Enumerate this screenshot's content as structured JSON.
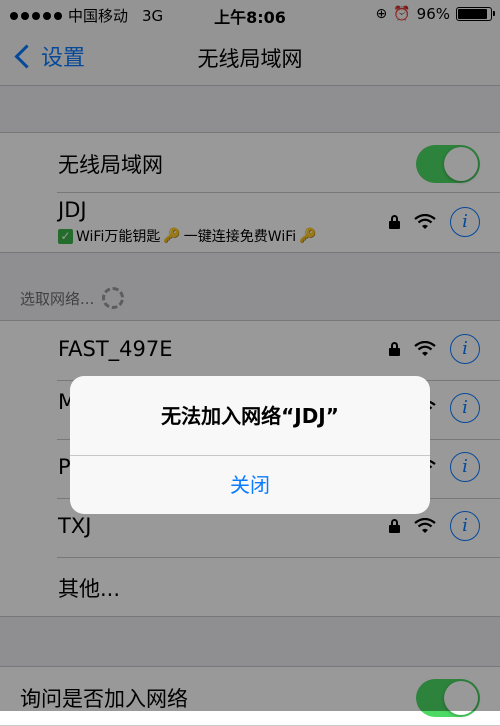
{
  "status_bar": {
    "carrier": "中国移动",
    "network": "3G",
    "time": "上午8:06",
    "battery_percent": "96%",
    "battery_level": 0.96,
    "icons": [
      "signal-dots",
      "rotation-lock-icon",
      "alarm-icon",
      "battery-icon"
    ]
  },
  "nav": {
    "back_label": "设置",
    "title": "无线局域网"
  },
  "wifi_toggle": {
    "label": "无线局域网",
    "on": true
  },
  "current_network": {
    "name": "JDJ",
    "subtitle_check": "✓",
    "subtitle": "WiFi万能钥匙",
    "subtitle2": "一键连接免费WiFi"
  },
  "choose_label": "选取网络...",
  "networks": [
    {
      "name": "FAST_497E"
    },
    {
      "name": "M"
    },
    {
      "name": "P"
    },
    {
      "name": "TXJ"
    }
  ],
  "other_label": "其他...",
  "ask_join": {
    "label": "询问是否加入网络",
    "on": true
  },
  "alert": {
    "message": "无法加入网络“JDJ”",
    "button": "关闭"
  },
  "colors": {
    "accent": "#0a7bff",
    "toggle_on": "#4cd964",
    "background": "#efeff4"
  }
}
